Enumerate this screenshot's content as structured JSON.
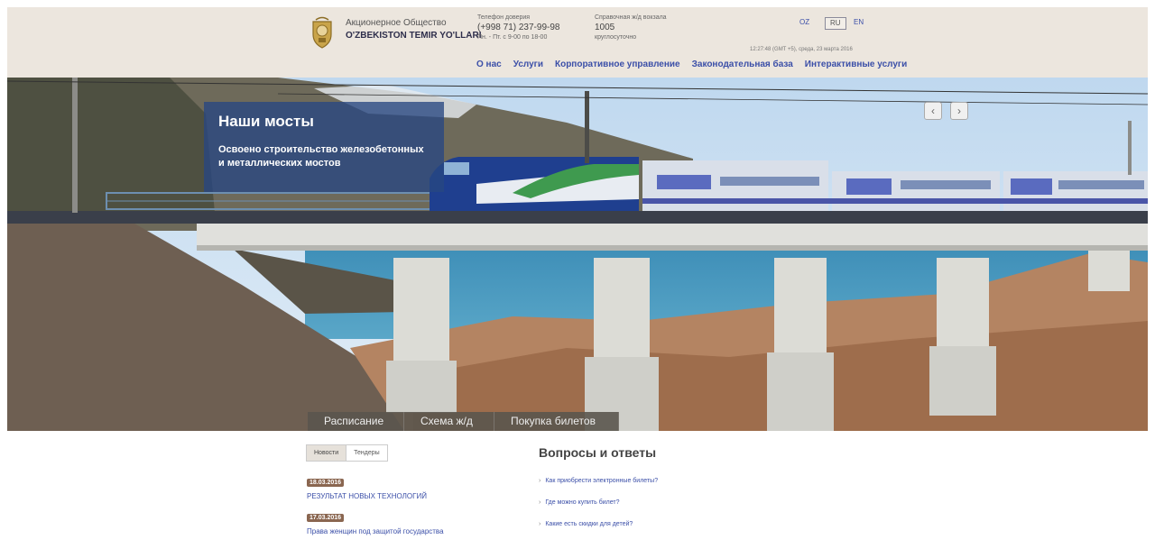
{
  "header": {
    "org_line1": "Акционерное Общество",
    "org_line2": "O'ZBEKISTON TEMIR YO'LLARI",
    "hotline_label": "Телефон доверия",
    "hotline_phone": "(+998 71) 237-99-98",
    "hotline_hours": "Пн. - Пт. с 9-00 по 18-00",
    "info_label": "Справочная ж/д вокзала",
    "info_number": "1005",
    "info_sub": "круглосуточно",
    "languages": [
      "OZ",
      "RU",
      "EN"
    ],
    "active_language": "RU",
    "datetime": "12:27:48 (GMT +5), среда, 23 марта 2016"
  },
  "nav": {
    "items": [
      "О нас",
      "Услуги",
      "Корпоративное управление",
      "Законодательная база",
      "Интерактивные услуги"
    ]
  },
  "hero": {
    "title": "Наши мосты",
    "text": "Освоено строительство железобетонных и металлических мостов",
    "prev_icon": "‹",
    "next_icon": "›",
    "tabs": [
      "Расписание",
      "Схема ж/д",
      "Покупка билетов"
    ]
  },
  "news": {
    "tabs": [
      "Новости",
      "Тендеры"
    ],
    "active_tab": "Новости",
    "items": [
      {
        "date": "18.03.2016",
        "title": "РЕЗУЛЬТАТ НОВЫХ ТЕХНОЛОГИЙ"
      },
      {
        "date": "17.03.2016",
        "title": "Права женщин под защитой государства"
      }
    ]
  },
  "faq": {
    "heading": "Вопросы и ответы",
    "items": [
      "Как приобрести электронные билеты?",
      "Где можно купить билет?",
      "Какие есть скидки для детей?"
    ]
  },
  "colors": {
    "header_bg": "#ece6de",
    "link": "#3b4fa8",
    "caption_bg": "#284682",
    "date_badge": "#8a6650"
  }
}
